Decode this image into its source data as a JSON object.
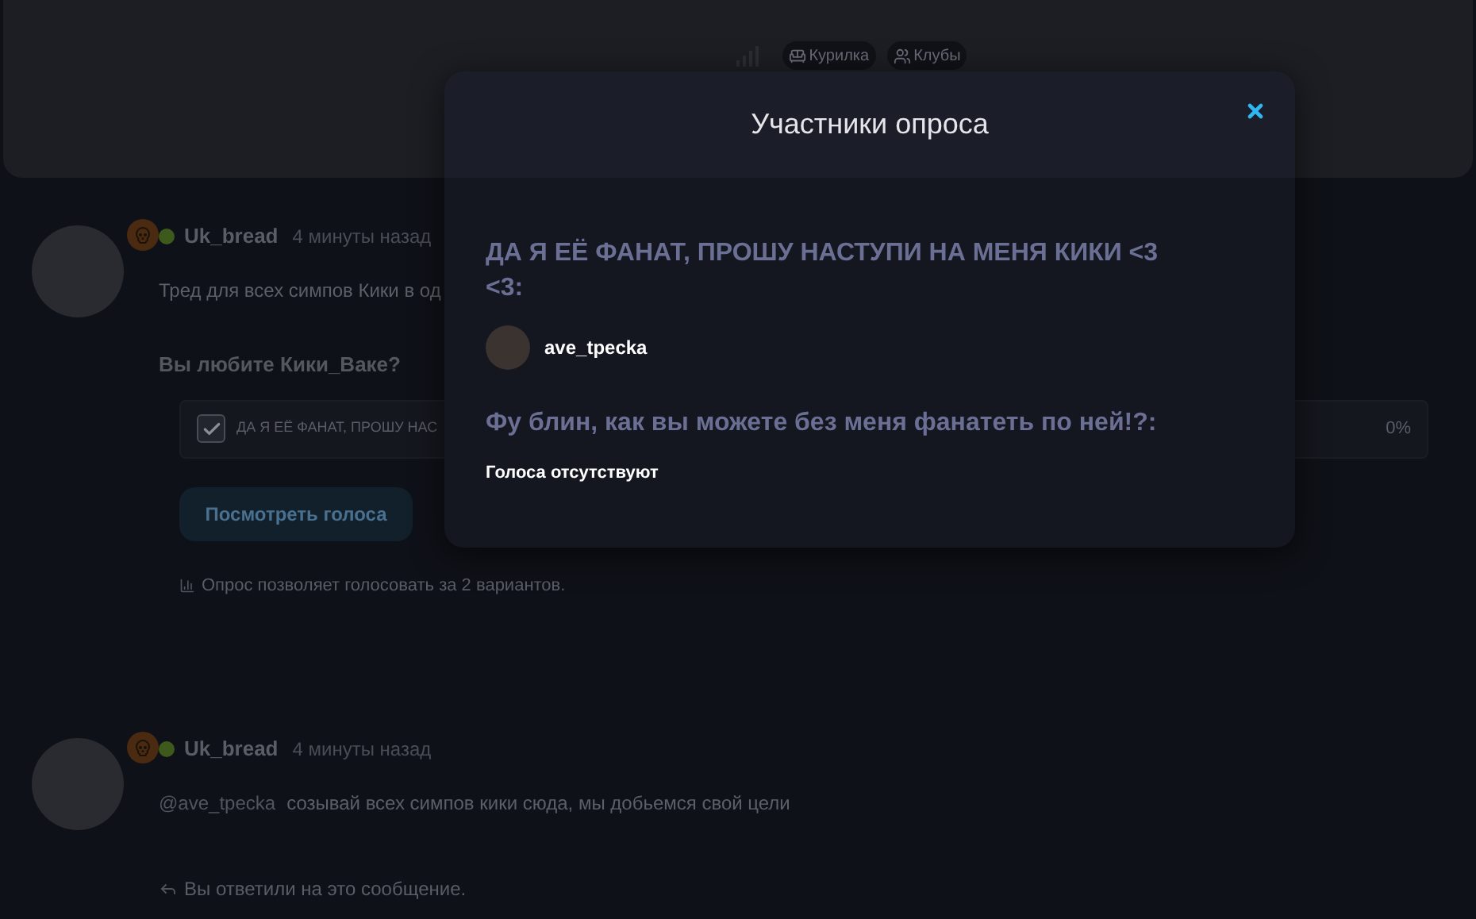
{
  "header": {
    "chips": [
      {
        "label": "Курилка"
      },
      {
        "label": "Клубы"
      }
    ]
  },
  "posts": [
    {
      "author": "Uk_bread",
      "online": true,
      "time": "4 минуты назад",
      "text": "Тред для всех симпов Кики в од",
      "poll": {
        "question": "Вы любите Кики_Ваке?",
        "options": [
          {
            "text": "ДА Я ЕЁ ФАНАТ, ПРОШУ НАС",
            "checked": true,
            "percent": "0%"
          }
        ],
        "button": "Посмотреть голоса",
        "note": "Опрос позволяет голосовать за 2 вариантов."
      }
    },
    {
      "author": "Uk_bread",
      "online": true,
      "time": "4 минуты назад",
      "mention": "@ave_tpecka",
      "text": "созывай всех симпов кики сюда, мы добьемся свой цели",
      "reply_note": "Вы ответили на это сообщение."
    }
  ],
  "modal": {
    "title": "Участники опроса",
    "groups": [
      {
        "option": "ДА Я ЕЁ ФАНАТ, ПРОШУ НАСТУПИ НА МЕНЯ КИКИ <3 <3:",
        "voters": [
          {
            "name": "ave_tpecka"
          }
        ]
      },
      {
        "option": "Фу блин, как вы можете без меня фанатеть по ней!?:",
        "empty_text": "Голоса отсутствуют"
      }
    ]
  }
}
